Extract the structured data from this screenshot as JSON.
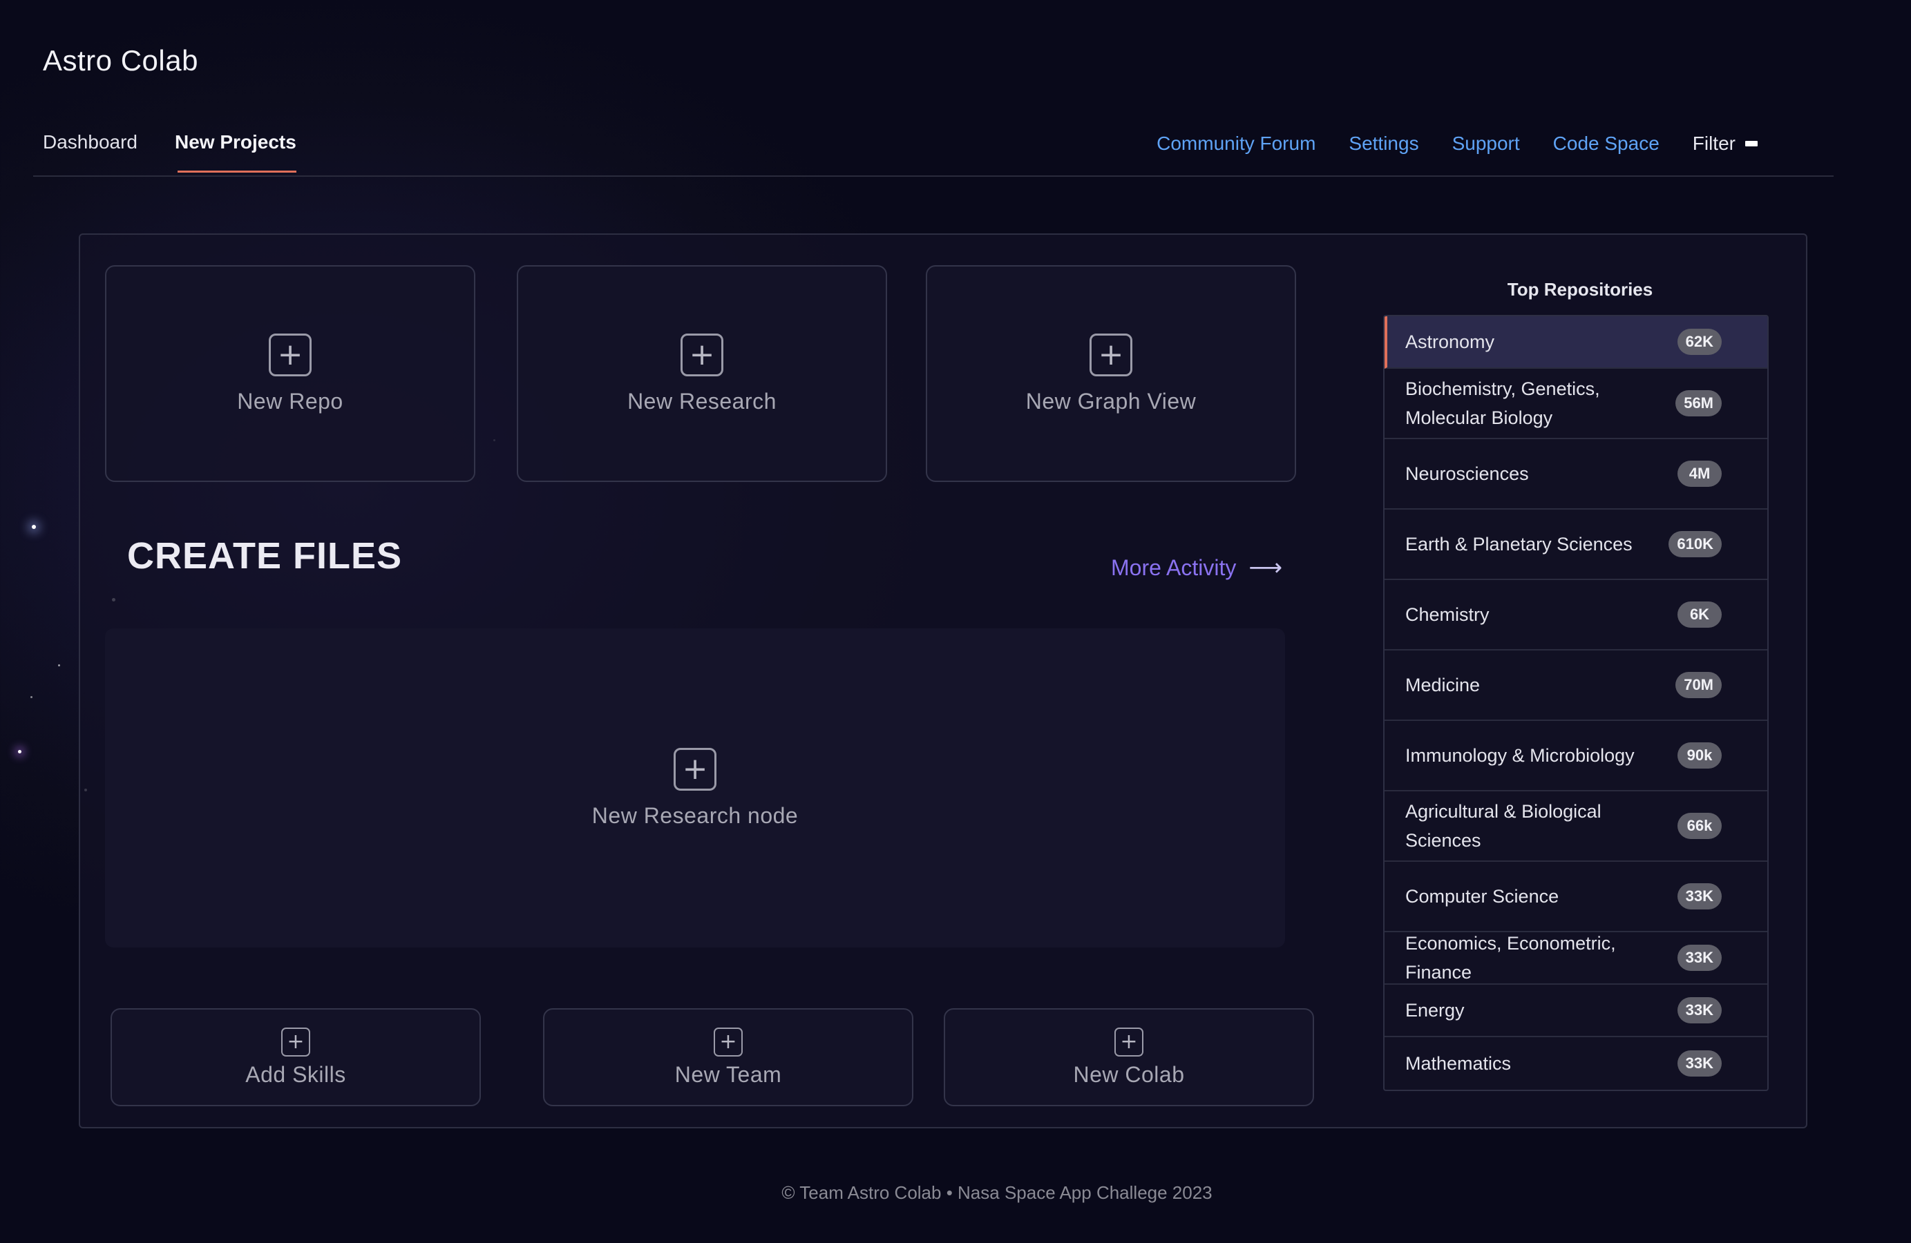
{
  "app": {
    "title": "Astro Colab"
  },
  "nav": {
    "tabs": [
      {
        "label": "Dashboard"
      },
      {
        "label": "New Projects",
        "active": true
      }
    ],
    "links": [
      {
        "label": "Community Forum"
      },
      {
        "label": "Settings"
      },
      {
        "label": "Support"
      },
      {
        "label": "Code Space"
      }
    ],
    "filter_label": "Filter"
  },
  "top_cards": [
    {
      "label": "New Repo",
      "icon": "plus-square-icon"
    },
    {
      "label": "New Research",
      "icon": "plus-square-icon"
    },
    {
      "label": "New Graph View",
      "icon": "plus-square-icon"
    }
  ],
  "create_files": {
    "title": "CREATE FILES",
    "more_activity": "More Activity",
    "node_label": "New Research node"
  },
  "bottom_cards": [
    {
      "label": "Add Skills",
      "icon": "plus-square-icon"
    },
    {
      "label": "New Team",
      "icon": "plus-square-icon"
    },
    {
      "label": "New Colab",
      "icon": "plus-square-icon"
    }
  ],
  "repositories": {
    "title": "Top Repositories",
    "items": [
      {
        "name": "Astronomy",
        "count": "62K",
        "active": true
      },
      {
        "name": "Biochemistry, Genetics, Molecular Biology",
        "count": "56M"
      },
      {
        "name": "Neurosciences",
        "count": "4M"
      },
      {
        "name": "Earth & Planetary Sciences",
        "count": "610K"
      },
      {
        "name": "Chemistry",
        "count": "6K"
      },
      {
        "name": "Medicine",
        "count": "70M"
      },
      {
        "name": "Immunology & Microbiology",
        "count": "90k"
      },
      {
        "name": "Agricultural & Biological Sciences",
        "count": "66k"
      },
      {
        "name": "Computer Science",
        "count": "33K"
      },
      {
        "name": "Economics, Econometric, Finance",
        "count": "33K"
      },
      {
        "name": "Energy",
        "count": "33K"
      },
      {
        "name": "Mathematics",
        "count": "33K"
      }
    ]
  },
  "footer": {
    "text": "© Team Astro Colab • Nasa Space App Challege 2023"
  },
  "colors": {
    "accent_underline": "#e0705a",
    "link": "#5fa3f5",
    "more_activity": "#8a72f0",
    "badge": "#5e5e68"
  }
}
